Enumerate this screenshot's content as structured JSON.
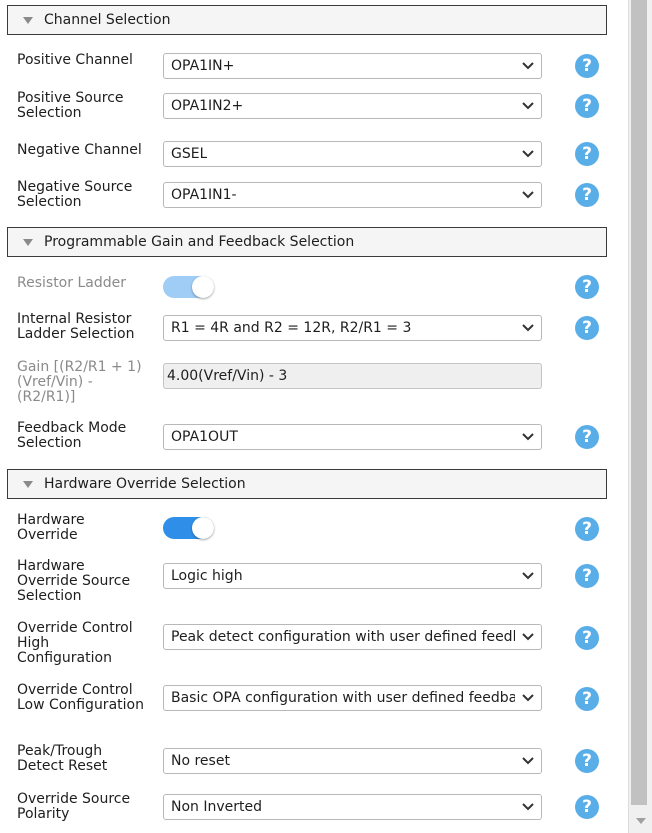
{
  "sections": [
    {
      "title": "Channel Selection"
    },
    {
      "title": "Programmable Gain and Feedback Selection"
    },
    {
      "title": "Hardware Override Selection"
    }
  ],
  "fields": {
    "positive_channel": {
      "label": "Positive Channel",
      "value": "OPA1IN+"
    },
    "positive_source": {
      "label": "Positive Source Selection",
      "value": "OPA1IN2+"
    },
    "negative_channel": {
      "label": "Negative Channel",
      "value": "GSEL"
    },
    "negative_source": {
      "label": "Negative Source Selection",
      "value": "OPA1IN1-"
    },
    "resistor_ladder": {
      "label": "Resistor Ladder",
      "state": "on",
      "enabled": false
    },
    "internal_resistor": {
      "label": "Internal Resistor Ladder Selection",
      "value": "R1 = 4R and R2 = 12R, R2/R1 = 3"
    },
    "gain": {
      "label": "Gain [(R2/R1 + 1)(Vref/Vin) - (R2/R1)]",
      "value": "4.00(Vref/Vin) - 3"
    },
    "feedback_mode": {
      "label": "Feedback Mode Selection",
      "value": "OPA1OUT"
    },
    "hardware_override": {
      "label": "Hardware Override",
      "state": "on",
      "enabled": true
    },
    "hw_override_source": {
      "label": "Hardware Override Source Selection",
      "value": "Logic high"
    },
    "override_high": {
      "label": "Override Control High Configuration",
      "value": "Peak detect configuration with user defined feedback"
    },
    "override_low": {
      "label": "Override Control Low Configuration",
      "value": "Basic OPA configuration with user defined feedback"
    },
    "peak_trough": {
      "label": "Peak/Trough Detect Reset",
      "value": "No reset"
    },
    "override_polarity": {
      "label": "Override Source Polarity",
      "value": "Non Inverted"
    }
  },
  "help_glyph": "?",
  "colors": {
    "help_icon": "#5aaee8",
    "toggle_on": "#2f8fe8",
    "toggle_disabled": "#9fcdf6",
    "header_border": "#3a3a3a"
  },
  "icons": {
    "section_toggle": "collapse-triangle-icon",
    "dropdown": "chevron-down-icon",
    "help": "help-icon"
  }
}
